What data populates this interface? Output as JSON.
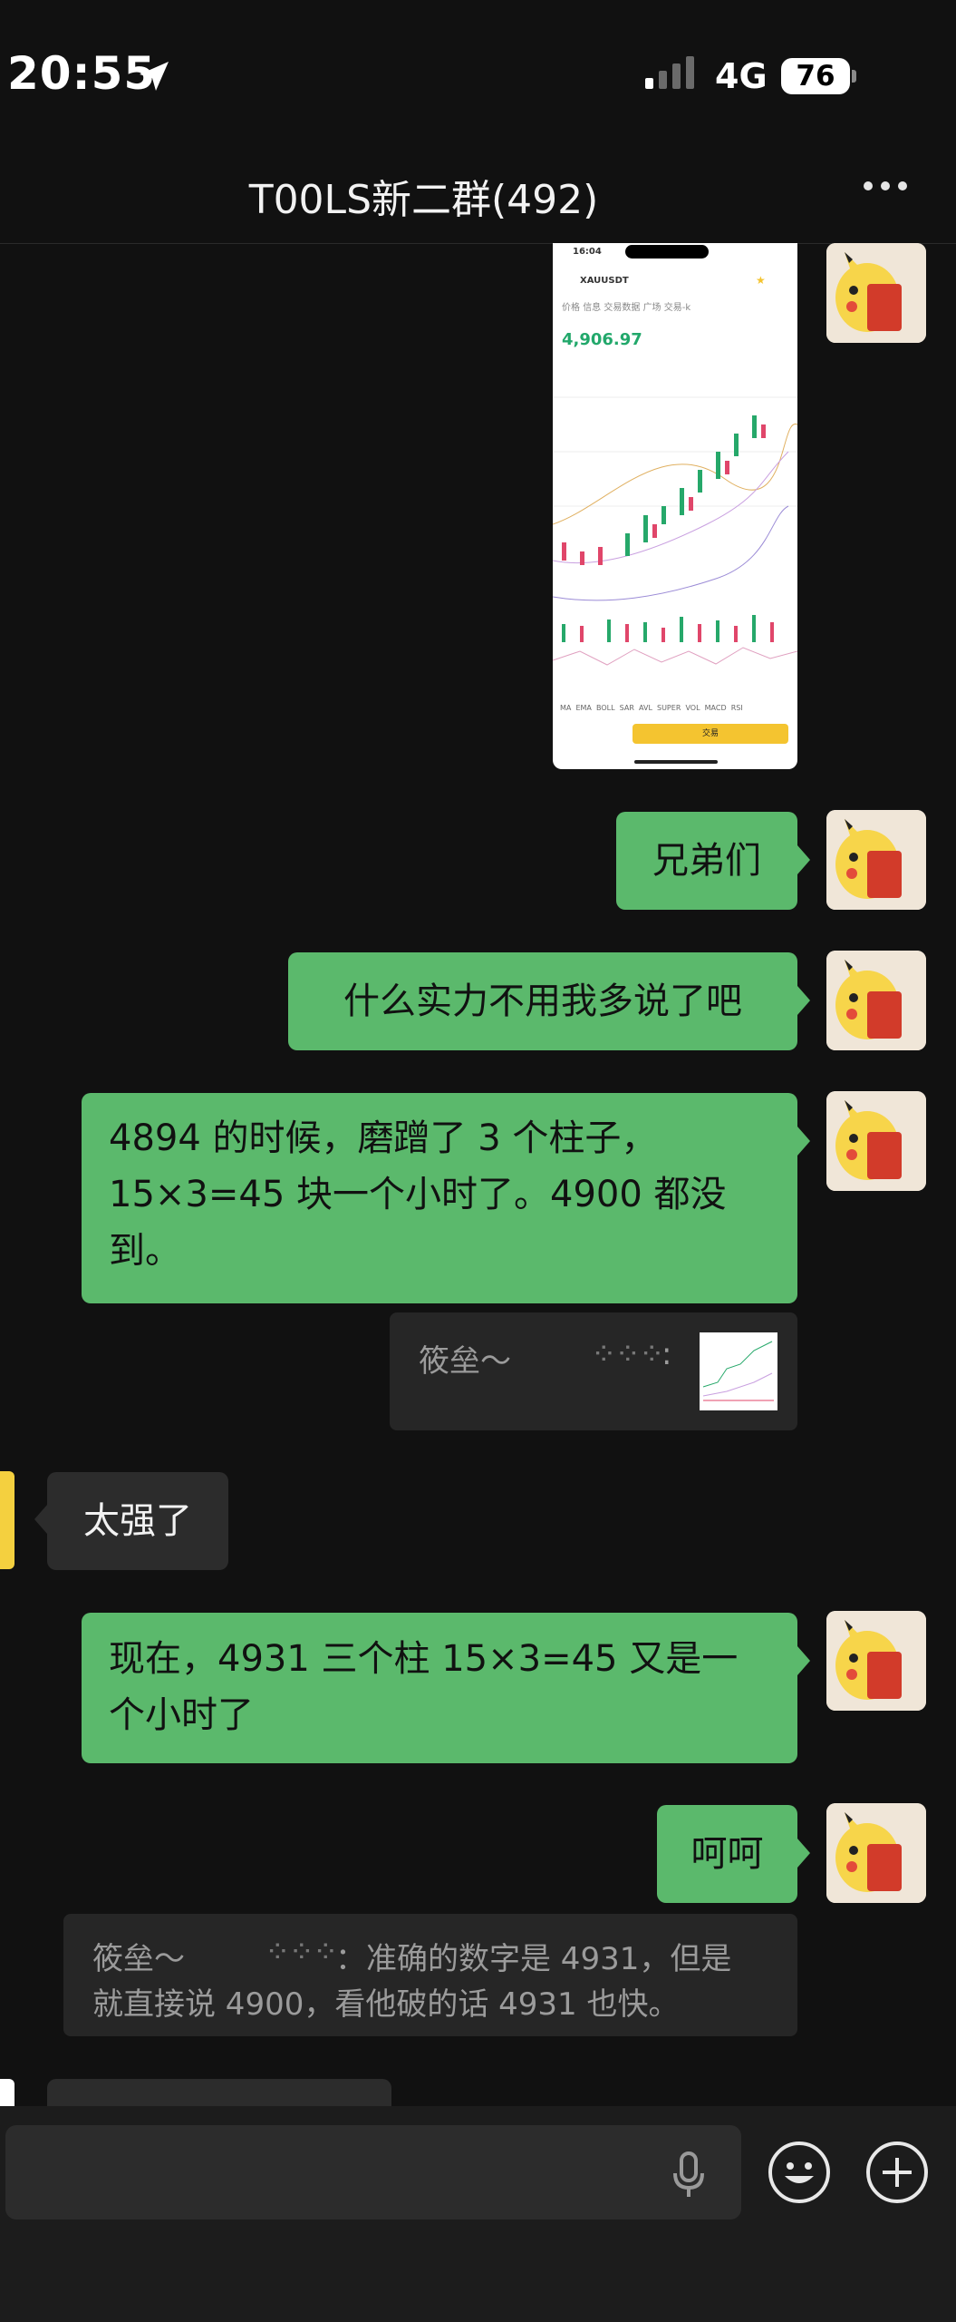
{
  "status": {
    "time": "20:55",
    "network": "4G",
    "battery": "76"
  },
  "header": {
    "title": "T00LS新二群(492)"
  },
  "screenshot": {
    "status_time": "16:04",
    "symbol": "XAUUSDT",
    "price": "4,906.97",
    "tabs": [
      "价格",
      "信息",
      "交易数据",
      "广场",
      "交易-k"
    ],
    "indicators": [
      "MA",
      "EMA",
      "BOLL",
      "SAR",
      "AVL",
      "SUPER",
      "VOL",
      "MACD",
      "RSI"
    ],
    "trade_button": "交易"
  },
  "messages": {
    "m1": "兄弟们",
    "m2": "什么实力不用我多说了吧",
    "m3_lines": [
      "4894 的时候，磨蹭了 3 个柱子，",
      "15×3=45 块一个小时了。4900 都没",
      "到。"
    ],
    "quote1_name": "筱垒～",
    "m4": "太强了",
    "m5_lines": [
      "现在，4931 三个柱 15×3=45 又是一",
      "个小时了"
    ],
    "m6": "呵呵",
    "quote2_line1_name": "筱垒～",
    "quote2_line1_text": "：准确的数字是 4931，但是",
    "quote2_line2": "就直接说 4900，看他破的话 4931 也快。"
  },
  "colors": {
    "background": "#111111",
    "green_bubble": "#5bb96c",
    "gray_bubble": "#2c2c2c"
  }
}
